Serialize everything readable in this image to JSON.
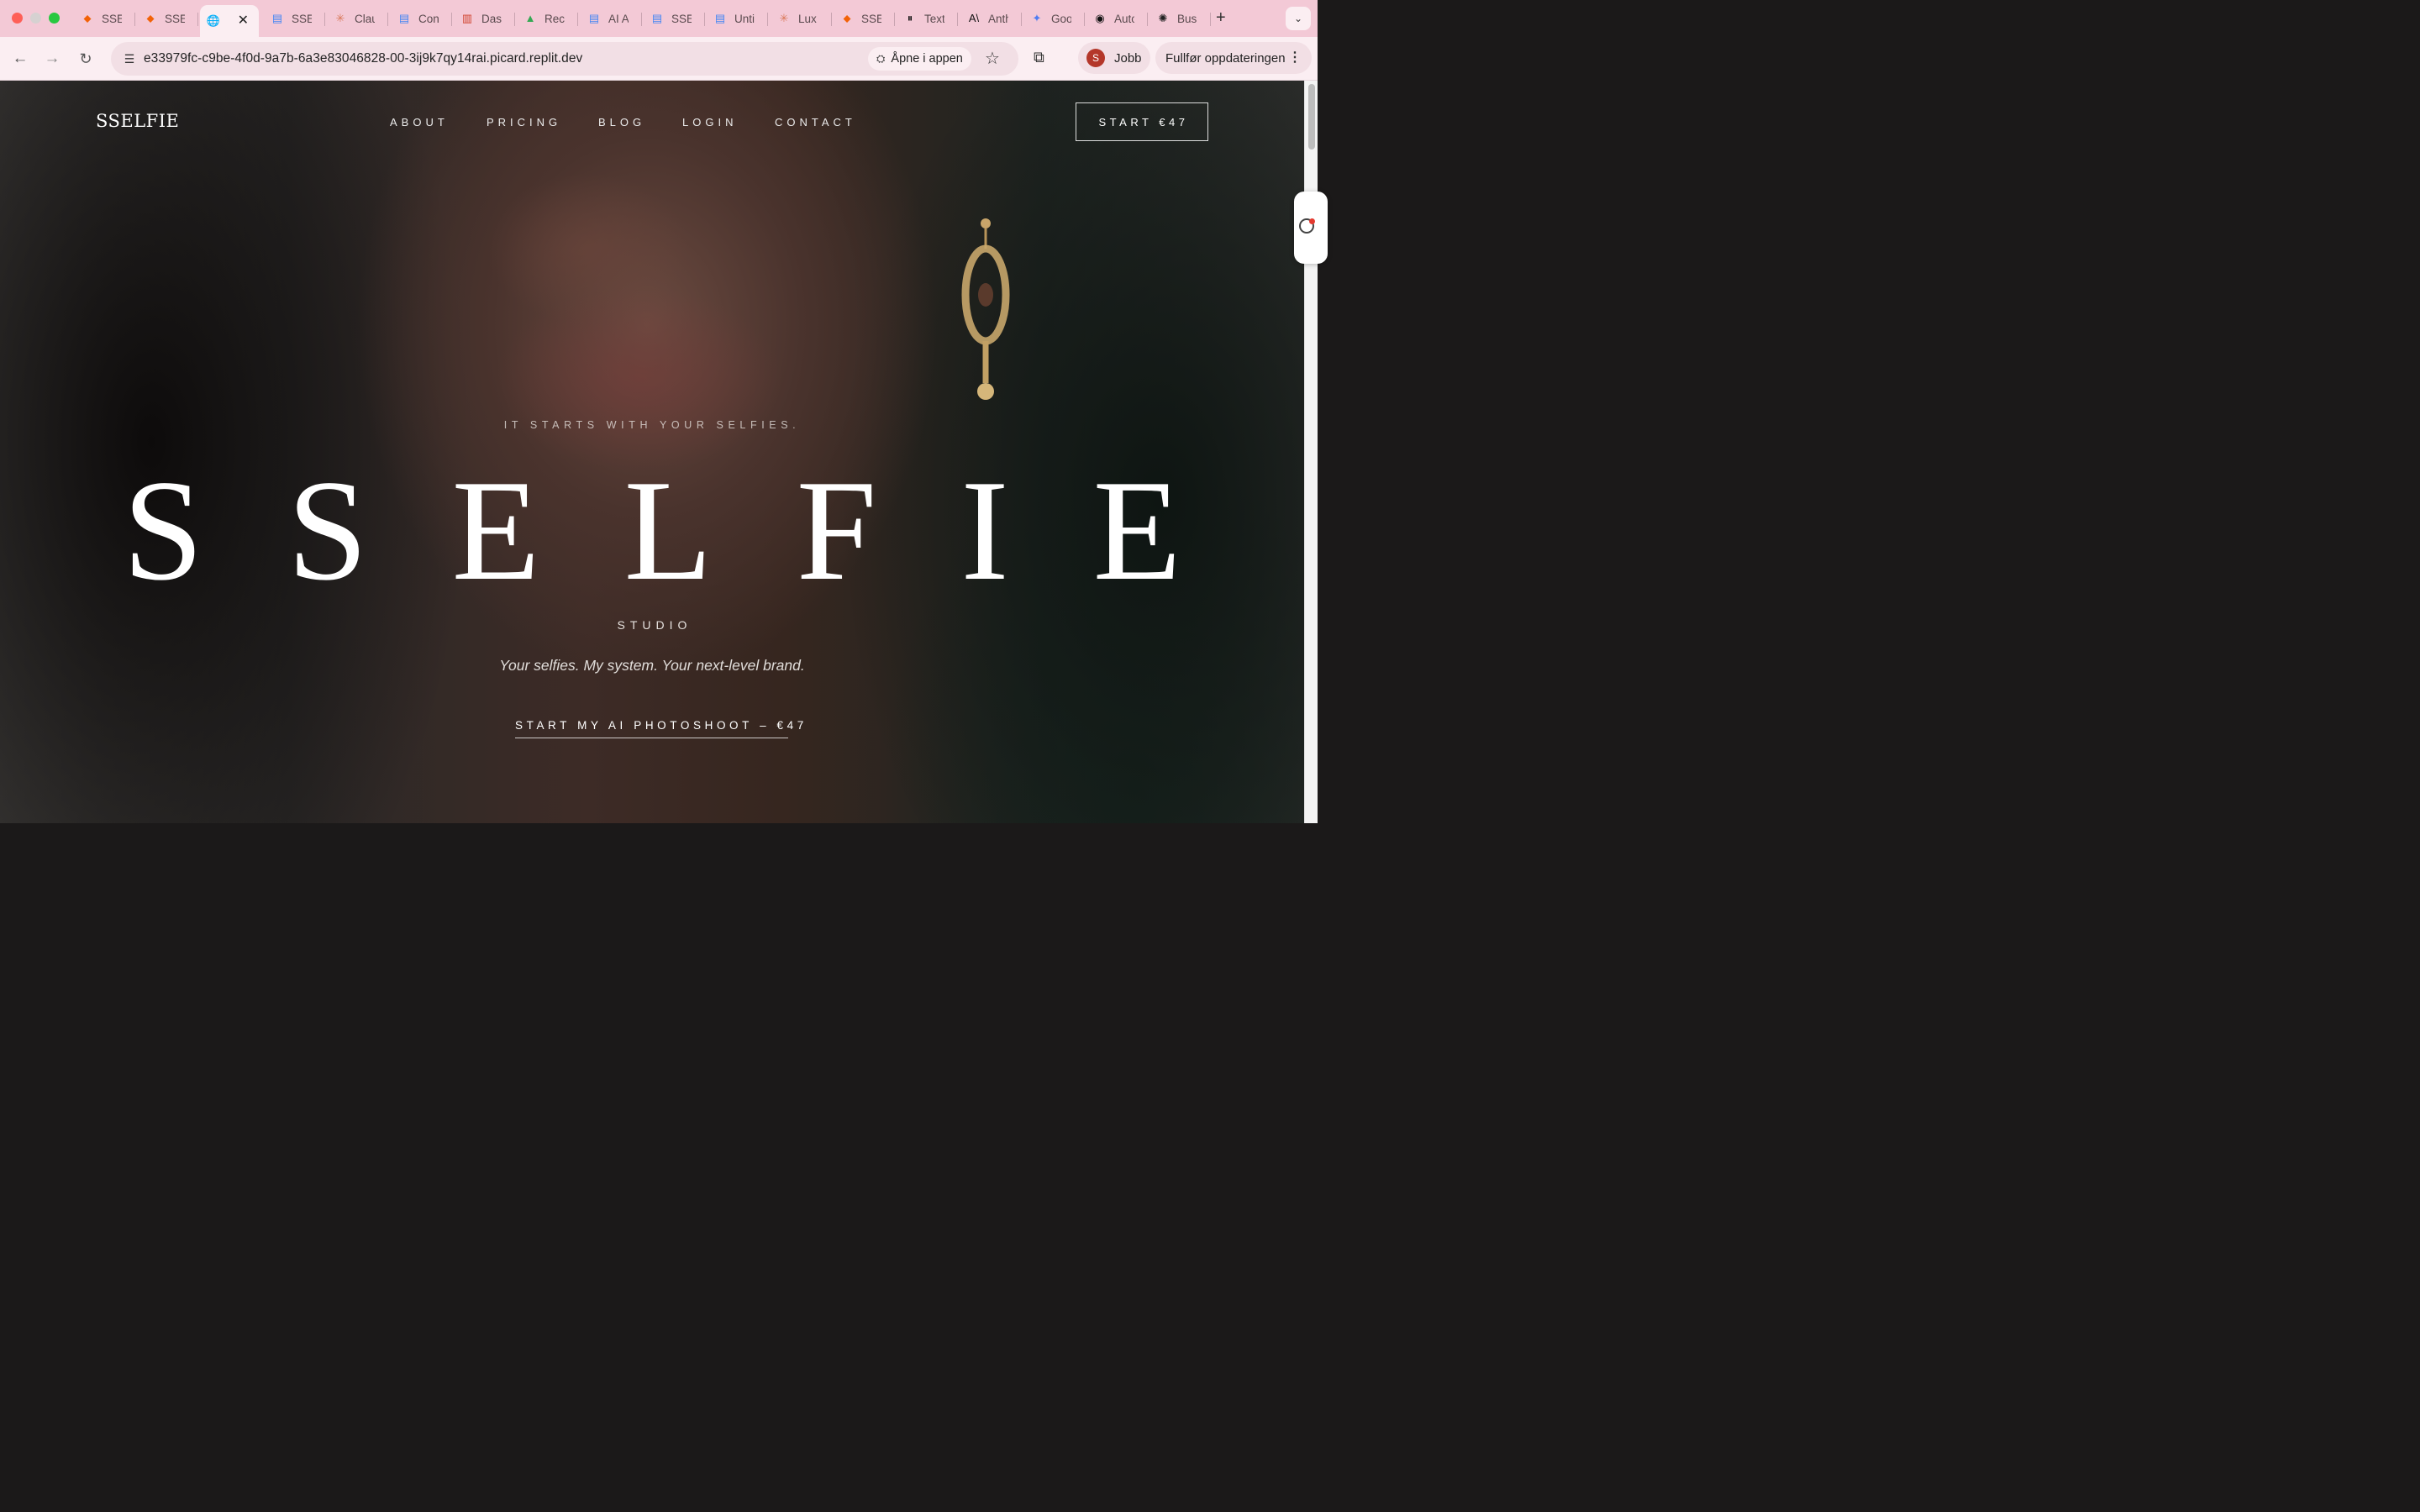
{
  "browser": {
    "tabs": [
      {
        "label": "SSE",
        "icon": "replit-icon",
        "glyph": "⬥",
        "color": "#f26207"
      },
      {
        "label": "SSE",
        "icon": "replit-icon",
        "glyph": "⬥",
        "color": "#f26207"
      },
      {
        "label": "",
        "icon": "globe-icon",
        "glyph": "🌐",
        "color": "#444444",
        "active": true
      },
      {
        "label": "SSE",
        "icon": "google-docs-icon",
        "glyph": "▤",
        "color": "#4285f4"
      },
      {
        "label": "Clau",
        "icon": "claude-icon",
        "glyph": "✳",
        "color": "#d97757"
      },
      {
        "label": "Con",
        "icon": "google-docs-icon",
        "glyph": "▤",
        "color": "#4285f4"
      },
      {
        "label": "Das",
        "icon": "dashboard-icon",
        "glyph": "▥",
        "color": "#d0422c"
      },
      {
        "label": "Rec",
        "icon": "google-drive-icon",
        "glyph": "▲",
        "color": "#34a853"
      },
      {
        "label": "AI A",
        "icon": "google-docs-icon",
        "glyph": "▤",
        "color": "#4285f4"
      },
      {
        "label": "SSE",
        "icon": "google-docs-icon",
        "glyph": "▤",
        "color": "#4285f4"
      },
      {
        "label": "Unti",
        "icon": "google-docs-icon",
        "glyph": "▤",
        "color": "#4285f4"
      },
      {
        "label": "Lux",
        "icon": "claude-icon",
        "glyph": "✳",
        "color": "#d97757"
      },
      {
        "label": "SSE",
        "icon": "replit-icon",
        "glyph": "⬥",
        "color": "#f26207"
      },
      {
        "label": "Text",
        "icon": "pause-app-icon",
        "glyph": "⏸",
        "color": "#111111"
      },
      {
        "label": "Anth",
        "icon": "anthropic-icon",
        "glyph": "A\\",
        "color": "#111111"
      },
      {
        "label": "Goo",
        "icon": "gemini-icon",
        "glyph": "✦",
        "color": "#4e7cf3"
      },
      {
        "label": "Auto",
        "icon": "automation-icon",
        "glyph": "◉",
        "color": "#111111"
      },
      {
        "label": "Bus",
        "icon": "openai-icon",
        "glyph": "✺",
        "color": "#222222"
      }
    ],
    "new_tab": "+",
    "tab_menu": "⌄",
    "url": "e33979fc-c9be-4f0d-9a7b-6a3e83046828-00-3ij9k7qy14rai.picard.replit.dev",
    "open_in_app": "Åpne i appen",
    "profile_initial": "S",
    "profile_name": "Jobb",
    "update_label": "Fullfør oppdateringen"
  },
  "site": {
    "logo": "SSELFIE",
    "nav": [
      "ABOUT",
      "PRICING",
      "BLOG",
      "LOGIN",
      "CONTACT"
    ],
    "nav_cta": "START €47",
    "hero": {
      "eyebrow": "IT STARTS WITH YOUR SELFIES.",
      "title": "SSELFIE",
      "subtitle": "STUDIO",
      "tagline": "Your selfies. My system. Your next-level brand.",
      "cta": "START MY AI PHOTOSHOOT – €47"
    }
  },
  "colors": {
    "tabstrip": "#f3c9d6",
    "toolbar": "#fbeef2",
    "hero_text": "#ffffff",
    "avatar": "#b4372a"
  }
}
